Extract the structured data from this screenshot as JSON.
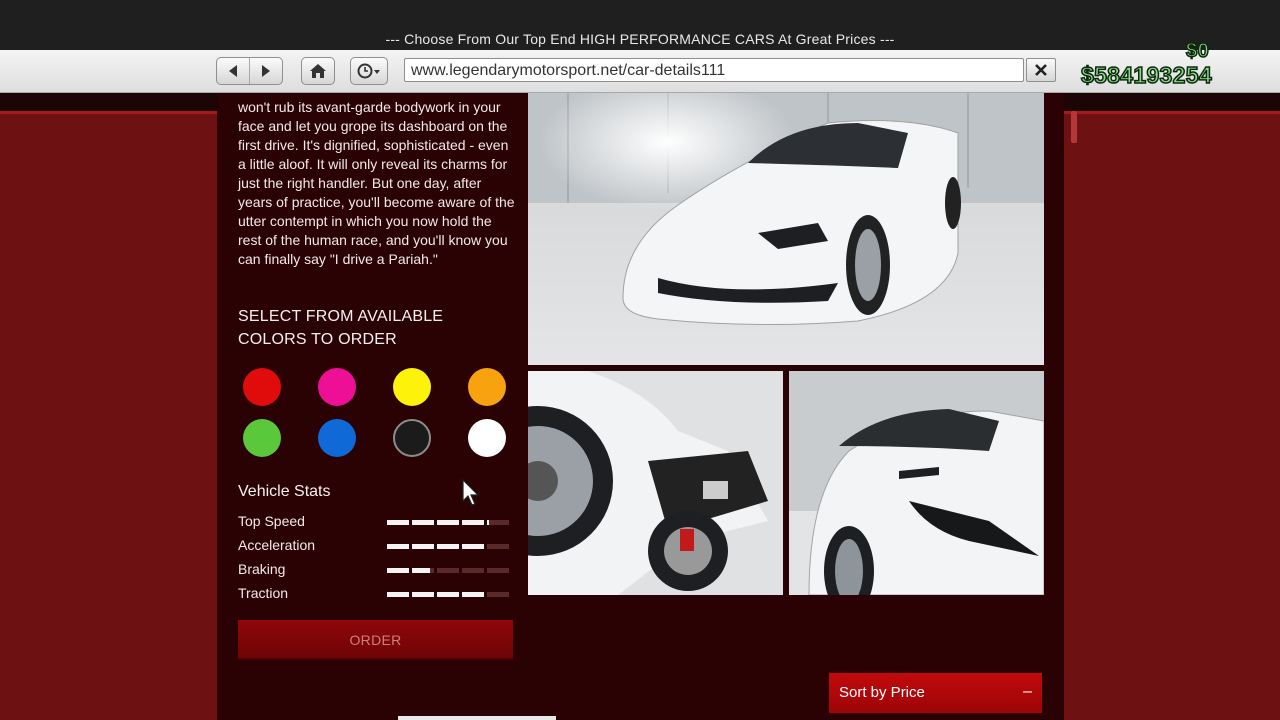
{
  "window": {
    "title": "--- Choose From Our Top End HIGH PERFORMANCE CARS At Great Prices ---"
  },
  "browser": {
    "back_icon": "back-arrow-icon",
    "forward_icon": "forward-arrow-icon",
    "home_icon": "home-icon",
    "history_icon": "clock-icon",
    "url": "www.legendarymotorsport.net/car-details111",
    "close_icon": "close-icon"
  },
  "hud": {
    "wallet": "$0",
    "bank": "$584193254"
  },
  "vehicle": {
    "description": "won't rub its avant-garde bodywork in your face and let you grope its dashboard on the first drive. It's dignified, sophisticated - even a little aloof. It will only reveal its charms for just the right handler. But one day, after years of practice, you'll become aware of the utter contempt in which you now hold the rest of the human race, and you'll know you can finally say \"I drive a Pariah.\"",
    "colors_title": "SELECT FROM AVAILABLE COLORS TO ORDER",
    "colors": [
      "#e00b0b",
      "#ee0f97",
      "#fcf20a",
      "#f7a20e",
      "#5ac83a",
      "#0f69d6",
      "#1c1b1b",
      "#ffffff"
    ],
    "stats_title": "Vehicle Stats",
    "stats": [
      {
        "label": "Top Speed",
        "value": 0.82
      },
      {
        "label": "Acceleration",
        "value": 0.8
      },
      {
        "label": "Braking",
        "value": 0.36
      },
      {
        "label": "Traction",
        "value": 0.8
      }
    ],
    "order_label": "ORDER"
  },
  "gallery": {
    "images": [
      "front-three-quarter-view",
      "rear-wheel-detail",
      "headlight-detail"
    ]
  },
  "sort": {
    "label": "Sort by Price",
    "toggle": "–"
  }
}
